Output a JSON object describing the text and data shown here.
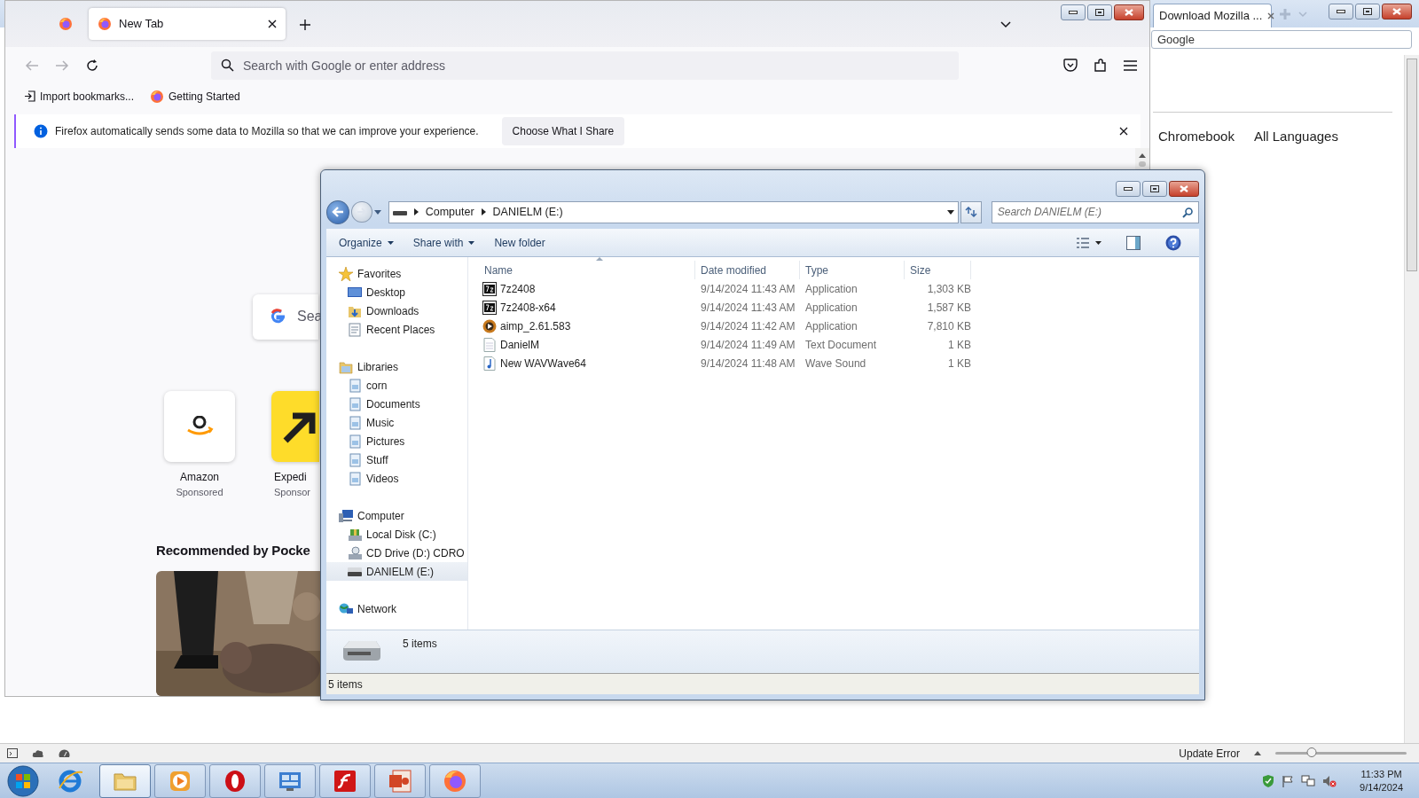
{
  "background_window": {
    "tab": {
      "title": "Download Mozilla ...",
      "selected": true
    },
    "search_field": {
      "value": "Google"
    },
    "links": [
      "Chromebook",
      "All Languages"
    ],
    "status_bar": {
      "message": "Update Error",
      "zoom": {
        "level": 0.28
      }
    }
  },
  "browser": {
    "tabs": [
      {
        "kind": "pinned",
        "selected": false
      },
      {
        "kind": "page",
        "label": "New Tab",
        "selected": true
      }
    ],
    "address_bar": {
      "placeholder": "Search with Google or enter address"
    },
    "bookmarks": [
      {
        "kind": "import",
        "label": "Import bookmarks..."
      },
      {
        "kind": "firefox",
        "label": "Getting Started"
      }
    ],
    "notification": {
      "message": "Firefox automatically sends some data to Mozilla so that we can improve your experience.",
      "button": "Choose What I Share"
    },
    "search": {
      "placeholder": "Sea"
    },
    "shortcuts": [
      {
        "kind": "amazon",
        "title": "Amazon",
        "label": "Sponsored"
      },
      {
        "kind": "expedia",
        "title": "Expedi",
        "label": "Sponsor"
      }
    ],
    "pocket": {
      "heading": "Recommended by Pocke"
    }
  },
  "explorer": {
    "breadcrumb": [
      "Computer",
      "DANIELM (E:)"
    ],
    "search": {
      "placeholder": "Search DANIELM (E:)"
    },
    "toolbar": [
      {
        "label": "Organize",
        "dropdown": true
      },
      {
        "label": "Share with",
        "dropdown": true
      },
      {
        "label": "New folder",
        "dropdown": false
      }
    ],
    "nav": [
      {
        "kind": "favorites",
        "label": "Favorites",
        "selected": false,
        "children": [
          {
            "kind": "desktop",
            "label": "Desktop",
            "selected": false
          },
          {
            "kind": "downloads",
            "label": "Downloads",
            "selected": false
          },
          {
            "kind": "recent",
            "label": "Recent Places",
            "selected": false
          }
        ]
      },
      {
        "kind": "libraries",
        "label": "Libraries",
        "selected": false,
        "children": [
          {
            "kind": "library",
            "label": "corn",
            "selected": false
          },
          {
            "kind": "library",
            "label": "Documents",
            "selected": false
          },
          {
            "kind": "library",
            "label": "Music",
            "selected": false
          },
          {
            "kind": "library",
            "label": "Pictures",
            "selected": false
          },
          {
            "kind": "library",
            "label": "Stuff",
            "selected": false
          },
          {
            "kind": "library",
            "label": "Videos",
            "selected": false
          }
        ]
      },
      {
        "kind": "computer",
        "label": "Computer",
        "selected": false,
        "children": [
          {
            "kind": "disk",
            "label": "Local Disk (C:)",
            "selected": false
          },
          {
            "kind": "cd",
            "label": "CD Drive (D:) CDRO",
            "selected": false
          },
          {
            "kind": "usb",
            "label": "DANIELM (E:)",
            "selected": true
          }
        ]
      },
      {
        "kind": "network",
        "label": "Network",
        "selected": false
      }
    ],
    "columns": [
      "Name",
      "Date modified",
      "Type",
      "Size"
    ],
    "files": [
      {
        "kind": "archiver",
        "name": "7z2408",
        "date": "9/14/2024 11:43 AM",
        "type": "Application",
        "size": "1,303 KB"
      },
      {
        "kind": "archiver",
        "name": "7z2408-x64",
        "date": "9/14/2024 11:43 AM",
        "type": "Application",
        "size": "1,587 KB"
      },
      {
        "kind": "player",
        "name": "aimp_2.61.583",
        "date": "9/14/2024 11:42 AM",
        "type": "Application",
        "size": "7,810 KB"
      },
      {
        "kind": "text",
        "name": "DanielM",
        "date": "9/14/2024 11:49 AM",
        "type": "Text Document",
        "size": "1 KB"
      },
      {
        "kind": "sound",
        "name": "New WAVWave64",
        "date": "9/14/2024 11:48 AM",
        "type": "Wave Sound",
        "size": "1 KB"
      }
    ],
    "details": {
      "count": "5 items"
    },
    "status_bar": "5 items"
  },
  "taskbar": {
    "items": [
      {
        "kind": "ie",
        "running": false,
        "selected": false
      },
      {
        "kind": "folder",
        "running": true,
        "selected": true
      },
      {
        "kind": "media",
        "running": true,
        "selected": false
      },
      {
        "kind": "opera",
        "running": true,
        "selected": false
      },
      {
        "kind": "control",
        "running": true,
        "selected": false
      },
      {
        "kind": "flash",
        "running": true,
        "selected": false
      },
      {
        "kind": "powerpoint",
        "running": true,
        "selected": false
      },
      {
        "kind": "firefox",
        "running": true,
        "selected": false
      }
    ],
    "clock": {
      "time": "11:33 PM",
      "date": "9/14/2024"
    }
  }
}
